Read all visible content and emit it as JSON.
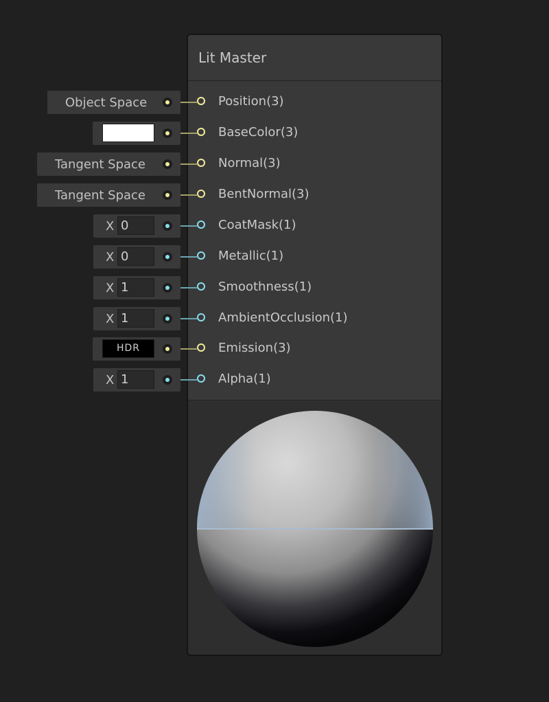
{
  "node": {
    "title": "Lit Master"
  },
  "ports": [
    {
      "label": "Position(3)",
      "color": "#f2ec9c",
      "input": {
        "kind": "dropdown",
        "text": "Object Space"
      }
    },
    {
      "label": "BaseColor(3)",
      "color": "#f2ec9c",
      "input": {
        "kind": "color",
        "value": "#ffffff"
      }
    },
    {
      "label": "Normal(3)",
      "color": "#f2ec9c",
      "input": {
        "kind": "dropdown",
        "text": "Tangent Space"
      }
    },
    {
      "label": "BentNormal(3)",
      "color": "#f2ec9c",
      "input": {
        "kind": "dropdown",
        "text": "Tangent Space"
      }
    },
    {
      "label": "CoatMask(1)",
      "color": "#88dfee",
      "input": {
        "kind": "vector1",
        "axis": "X",
        "value": "0"
      }
    },
    {
      "label": "Metallic(1)",
      "color": "#88dfee",
      "input": {
        "kind": "vector1",
        "axis": "X",
        "value": "0"
      }
    },
    {
      "label": "Smoothness(1)",
      "color": "#88dfee",
      "input": {
        "kind": "vector1",
        "axis": "X",
        "value": "1"
      }
    },
    {
      "label": "AmbientOcclusion(1)",
      "color": "#88dfee",
      "input": {
        "kind": "vector1",
        "axis": "X",
        "value": "1"
      }
    },
    {
      "label": "Emission(3)",
      "color": "#f2ec9c",
      "input": {
        "kind": "hdr-color",
        "text": "HDR"
      }
    },
    {
      "label": "Alpha(1)",
      "color": "#88dfee",
      "input": {
        "kind": "vector1",
        "axis": "X",
        "value": "1"
      }
    }
  ],
  "preview": {
    "icon": "sphere-preview"
  }
}
